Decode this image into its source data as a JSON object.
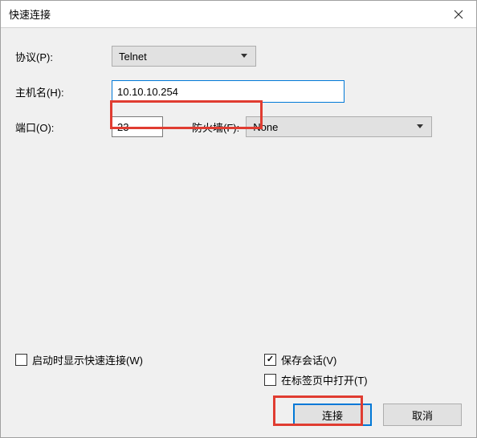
{
  "title": "快速连接",
  "fields": {
    "protocol_label": "协议(P):",
    "protocol_value": "Telnet",
    "hostname_label": "主机名(H):",
    "hostname_value": "10.10.10.254",
    "port_label": "端口(O):",
    "port_value": "23",
    "firewall_label": "防火墙(F):",
    "firewall_value": "None"
  },
  "checkboxes": {
    "show_on_startup": {
      "label": "启动时显示快速连接(W)",
      "checked": false
    },
    "save_session": {
      "label": "保存会话(V)",
      "checked": true
    },
    "open_in_tab": {
      "label": "在标签页中打开(T)",
      "checked": false
    }
  },
  "buttons": {
    "connect": "连接",
    "cancel": "取消"
  }
}
